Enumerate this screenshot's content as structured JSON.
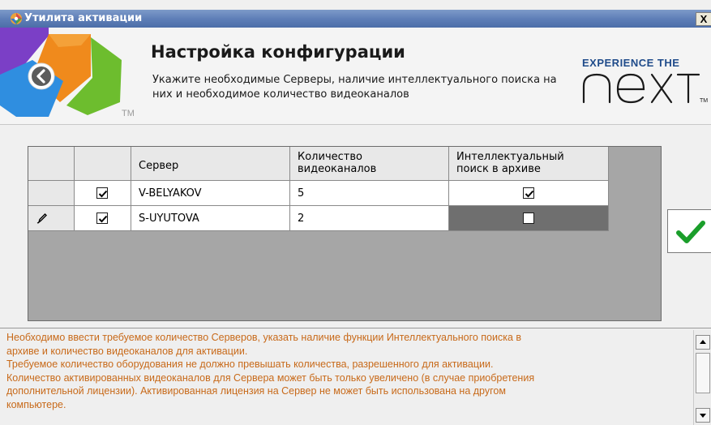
{
  "window": {
    "title": "Утилита активации",
    "close_label": "X"
  },
  "header": {
    "title": "Настройка конфигурации",
    "subtitle": "Укажите необходимые Серверы, наличие интеллектуального поиска на них и необходимое количество видеоканалов",
    "tm": "TM",
    "brand_tagline": "EXPERIENCE THE",
    "brand_word": "next",
    "brand_tm": "TM"
  },
  "grid": {
    "columns": [
      "",
      "",
      "Сервер",
      "Количество видеоканалов",
      "Интеллектуальный поиск в архиве"
    ],
    "column_lines": {
      "count": [
        "Количество",
        "видеоканалов"
      ],
      "search": [
        "Интеллектуальный",
        "поиск в архиве"
      ]
    },
    "rows": [
      {
        "editing": false,
        "selected": true,
        "server": "V-BELYAKOV",
        "channels": "5",
        "intelligent_search": true
      },
      {
        "editing": true,
        "selected": true,
        "server": "S-UYUTOVA",
        "channels": "2",
        "intelligent_search": false
      }
    ]
  },
  "info": {
    "lines": [
      "Необходимо ввести требуемое количество Серверов, указать наличие функции Интеллектуального поиска в",
      "архиве и количество видеоканалов для активации.",
      "Требуемое количество оборудования не должно превышать количества, разрешенного для активации.",
      "Количество активированных видеоканалов для Сервера может быть только увеличено (в случае приобретения",
      "дополнительной лицензии). Активированная лицензия на Сервер не может быть использована на другом",
      "компьютере."
    ]
  },
  "colors": {
    "info_text": "#c86a1a",
    "confirm_check": "#1a9e2a",
    "brand_blue": "#1f4b8a"
  },
  "icons": {
    "back": "back-arrow-icon",
    "confirm": "checkmark-icon",
    "edit": "pencil-icon"
  }
}
